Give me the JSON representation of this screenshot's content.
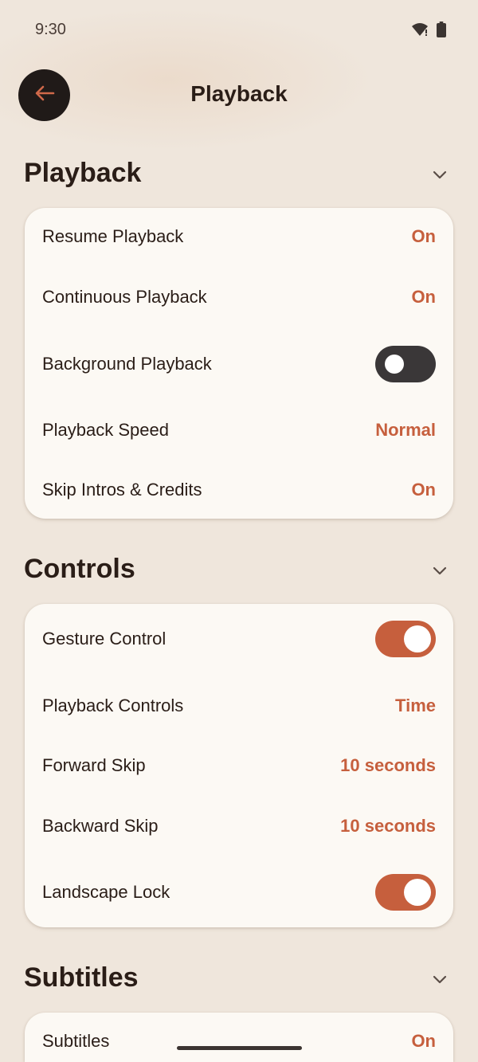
{
  "status_bar": {
    "time": "9:30",
    "icons": [
      "wifi-icon",
      "battery-icon"
    ]
  },
  "app_bar": {
    "back_icon": "arrow-left-icon",
    "title": "Playback"
  },
  "colors": {
    "accent": "#c65f3d",
    "background": "#efe6dc",
    "card": "#fcf9f4",
    "toggle_off": "#3a3738",
    "text": "#2a1d17"
  },
  "sections": {
    "playback": {
      "title": "Playback",
      "rows": [
        {
          "label": "Resume Playback",
          "value": "On"
        },
        {
          "label": "Continuous Playback",
          "value": "On"
        },
        {
          "label": "Background Playback",
          "toggle": false
        },
        {
          "label": "Playback Speed",
          "value": "Normal"
        },
        {
          "label": "Skip Intros & Credits",
          "value": "On"
        }
      ]
    },
    "controls": {
      "title": "Controls",
      "rows": [
        {
          "label": "Gesture Control",
          "toggle": true
        },
        {
          "label": "Playback Controls",
          "value": "Time"
        },
        {
          "label": "Forward Skip",
          "value": "10 seconds"
        },
        {
          "label": "Backward Skip",
          "value": "10 seconds"
        },
        {
          "label": "Landscape Lock",
          "toggle": true
        }
      ]
    },
    "subtitles": {
      "title": "Subtitles",
      "rows": [
        {
          "label": "Subtitles",
          "value": "On"
        }
      ]
    }
  }
}
